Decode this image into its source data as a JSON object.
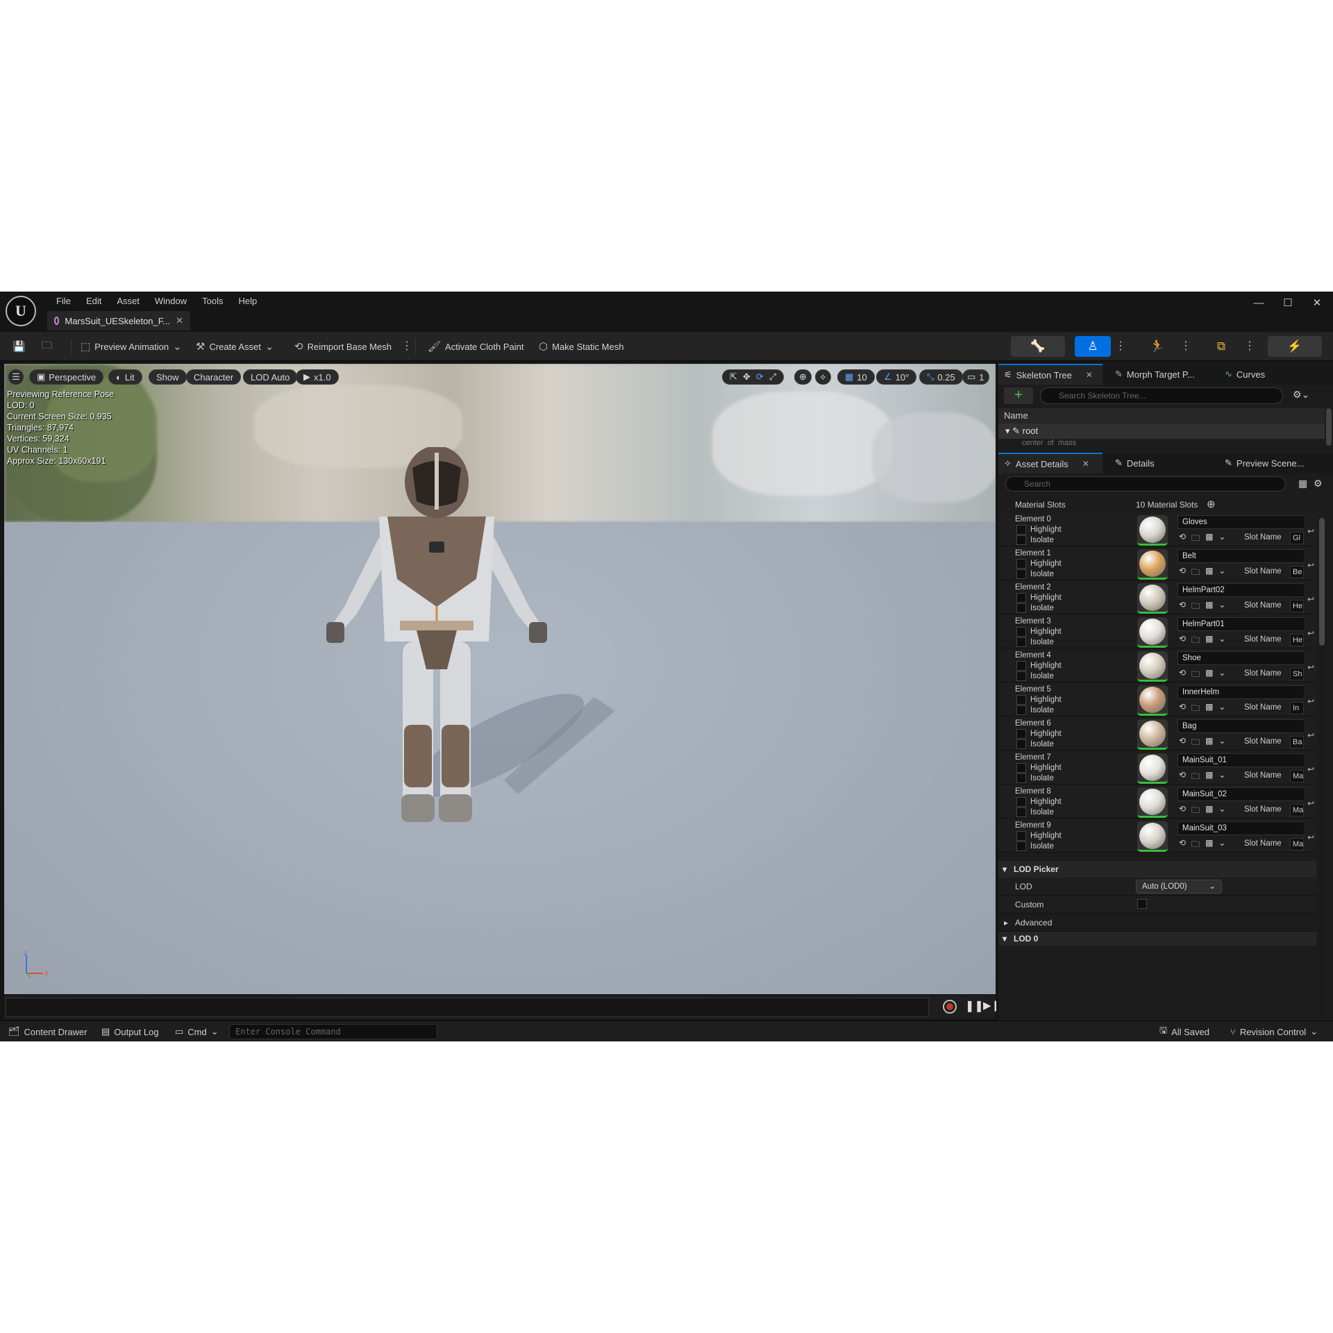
{
  "app": {
    "logo_letter": "U",
    "menu": [
      "File",
      "Edit",
      "Asset",
      "Window",
      "Tools",
      "Help"
    ],
    "doc_tab": "MarsSuit_UESkeleton_F...",
    "window_controls": [
      "minimize-icon",
      "maximize-icon",
      "close-icon"
    ]
  },
  "toolbar": {
    "save_icon": "save-icon",
    "browse_icon": "content-browser-icon",
    "preview_animation": "Preview Animation",
    "create_asset": "Create Asset",
    "reimport_base_mesh": "Reimport Base Mesh",
    "activate_cloth_paint": "Activate Cloth Paint",
    "make_static_mesh": "Make Static Mesh",
    "mode_buttons": [
      "skeleton-mode-icon",
      "mesh-mode-icon",
      "animation-mode-icon",
      "blueprint-mode-icon",
      "physics-mode-icon"
    ]
  },
  "viewport": {
    "perspective": "Perspective",
    "lit": "Lit",
    "show": "Show",
    "character": "Character",
    "lod": "LOD Auto",
    "play_rate": "x1.0",
    "grid_value": "10",
    "angle_value": "10°",
    "scale_value": "0.25",
    "camera_speed": "1",
    "stats": [
      "Previewing Reference Pose",
      "LOD: 0",
      "Current Screen Size: 0.935",
      "Triangles: 87,974",
      "Vertices: 59,324",
      "UV Channels: 1",
      "Approx Size: 130x60x191"
    ],
    "axis_z": "Z",
    "axis_x": "X"
  },
  "status": {
    "content_drawer": "Content Drawer",
    "output_log": "Output Log",
    "cmd": "Cmd",
    "console_placeholder": "Enter Console Command",
    "all_saved": "All Saved",
    "revision_control": "Revision Control"
  },
  "skeleton": {
    "tabs": [
      "Skeleton Tree",
      "Morph Target P...",
      "Curves"
    ],
    "search_placeholder": "Search Skeleton Tree...",
    "name_header": "Name",
    "root": "root",
    "child_partial": "center_of_mass"
  },
  "details": {
    "tabs": [
      "Asset Details",
      "Details",
      "Preview Scene..."
    ],
    "search_placeholder": "Search",
    "material_slots_label": "Material Slots",
    "material_slots_count": "10 Material Slots",
    "highlight": "Highlight",
    "isolate": "Isolate",
    "slot_name_label": "Slot Name",
    "elements": [
      {
        "label": "Element 0",
        "material": "Gloves",
        "slot": "Gl",
        "color": "#d8d6d0"
      },
      {
        "label": "Element 1",
        "material": "Belt",
        "slot": "Be",
        "color": "#d9a35a"
      },
      {
        "label": "Element 2",
        "material": "HelmPart02",
        "slot": "He",
        "color": "#cfc8bb"
      },
      {
        "label": "Element 3",
        "material": "HelmPart01",
        "slot": "He",
        "color": "#e2e0dc"
      },
      {
        "label": "Element 4",
        "material": "Shoe",
        "slot": "Sh",
        "color": "#d4ccbf"
      },
      {
        "label": "Element 5",
        "material": "InnerHelm",
        "slot": "In",
        "color": "#c89a78"
      },
      {
        "label": "Element 6",
        "material": "Bag",
        "slot": "Ba",
        "color": "#cdb89c"
      },
      {
        "label": "Element 7",
        "material": "MainSuit_01",
        "slot": "Ma",
        "color": "#e4e2dd"
      },
      {
        "label": "Element 8",
        "material": "MainSuit_02",
        "slot": "Ma",
        "color": "#e0ddd6"
      },
      {
        "label": "Element 9",
        "material": "MainSuit_03",
        "slot": "Ma",
        "color": "#d7d2ca"
      }
    ],
    "lod_picker": "LOD Picker",
    "lod_label": "LOD",
    "lod_value": "Auto (LOD0)",
    "custom_label": "Custom",
    "advanced": "Advanced",
    "lod0": "LOD 0"
  }
}
